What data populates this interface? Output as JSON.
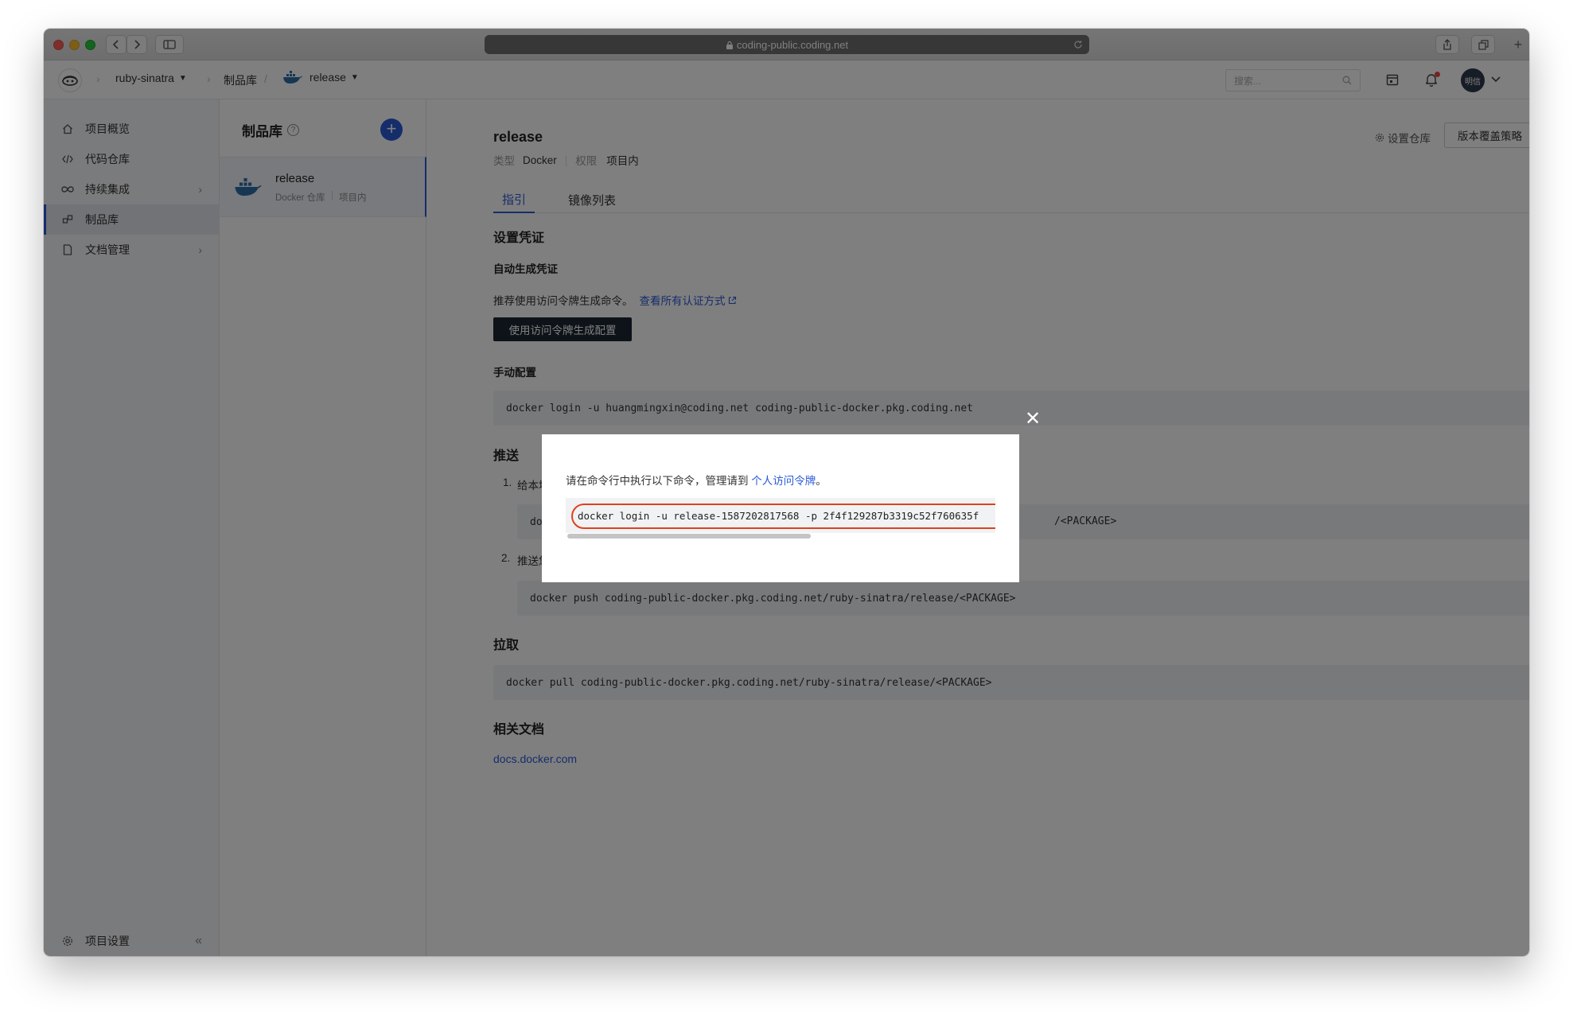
{
  "browser": {
    "url": "coding-public.coding.net"
  },
  "topnav": {
    "project": "ruby-sinatra",
    "section": "制品库",
    "repo": "release",
    "search_placeholder": "搜索...",
    "avatar_text": "明信"
  },
  "sidebar": {
    "items": [
      {
        "label": "项目概览"
      },
      {
        "label": "代码仓库"
      },
      {
        "label": "持续集成"
      },
      {
        "label": "制品库"
      },
      {
        "label": "文档管理"
      }
    ],
    "settings_label": "项目设置"
  },
  "repocol": {
    "title": "制品库",
    "repo_name": "release",
    "repo_meta_type": "Docker 仓库",
    "repo_meta_scope": "项目内"
  },
  "main": {
    "title": "release",
    "type_label": "类型",
    "type_value": "Docker",
    "perm_label": "权限",
    "perm_value": "项目内",
    "settings_link": "设置仓库",
    "policy_button": "版本覆盖策略",
    "tabs": [
      {
        "label": "指引"
      },
      {
        "label": "镜像列表"
      }
    ],
    "credential_heading": "设置凭证",
    "auto_heading": "自动生成凭证",
    "auto_desc": "推荐使用访问令牌生成命令。",
    "auto_link": "查看所有认证方式",
    "auto_button": "使用访问令牌生成配置",
    "manual_heading": "手动配置",
    "manual_cmd": "docker login -u huangmingxin@coding.net coding-public-docker.pkg.coding.net",
    "push_heading": "推送",
    "push_step1_num": "1.",
    "push_step1": "给本地的镜像",
    "push_step1_cmd_start": "docker ta",
    "push_step1_cmd_end": "/<PACKAGE>",
    "push_step2_num": "2.",
    "push_step2": "推送您的 doc",
    "push_step2_cmd": "docker push coding-public-docker.pkg.coding.net/ruby-sinatra/release/<PACKAGE>",
    "pull_heading": "拉取",
    "pull_cmd": "docker pull coding-public-docker.pkg.coding.net/ruby-sinatra/release/<PACKAGE>",
    "docs_heading": "相关文档",
    "docs_link": "docs.docker.com"
  },
  "modal": {
    "text_before": "请在命令行中执行以下命令，管理请到 ",
    "text_link": "个人访问令牌",
    "text_after": "。",
    "command": "docker login -u release-1587202817568 -p 2f4f129287b3319c52f760635f",
    "scroll_fraction": 0.57
  },
  "colors": {
    "accent": "#2b5bd7",
    "highlight_ring": "#e0401f",
    "dark_button": "#1d2633"
  },
  "icons": [
    "home-icon",
    "code-icon",
    "infinity-icon",
    "package-icon",
    "document-icon",
    "gear-icon",
    "docker-whale-icon",
    "bell-icon",
    "calendar-icon",
    "search-icon",
    "help-icon",
    "plus-icon",
    "close-icon",
    "lock-icon",
    "reload-icon",
    "share-icon",
    "tabs-icon"
  ]
}
